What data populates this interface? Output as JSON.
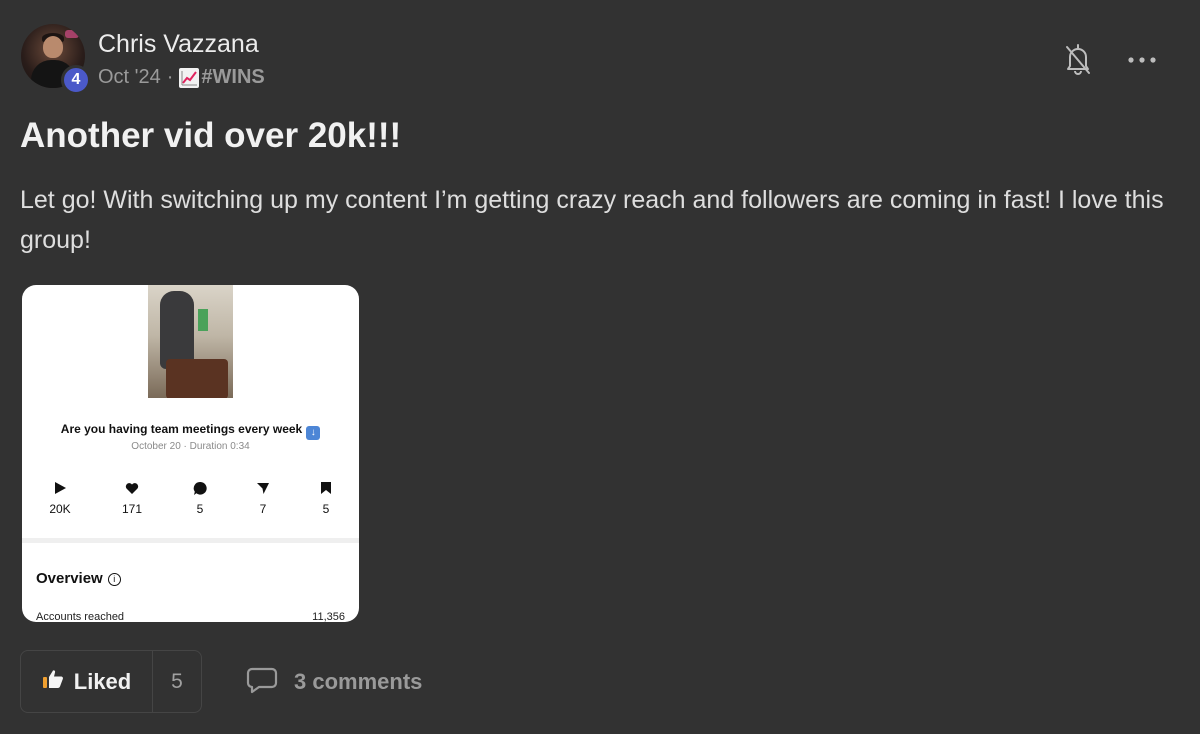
{
  "post": {
    "author": "Chris Vazzana",
    "level": "4",
    "date": "Oct '24",
    "separator": "·",
    "category": "#WINS",
    "category_icon": "chart-increasing-icon",
    "title": "Another vid over 20k!!!",
    "body": "Let go! With switching up my content I’m getting crazy reach and followers are coming in fast! I love this group!"
  },
  "attachment": {
    "caption": "Are you having team meetings every week",
    "subcaption": "October 20 · Duration 0:34",
    "stats": [
      {
        "icon": "play-icon",
        "value": "20K"
      },
      {
        "icon": "heart-icon",
        "value": "171"
      },
      {
        "icon": "comment-icon",
        "value": "5"
      },
      {
        "icon": "share-icon",
        "value": "7"
      },
      {
        "icon": "bookmark-icon",
        "value": "5"
      }
    ],
    "overview_label": "Overview",
    "accounts_reached_label": "Accounts reached",
    "accounts_reached_value": "11,356"
  },
  "actions": {
    "like_label": "Liked",
    "like_count": "5",
    "comments_label": "3 comments"
  },
  "colors": {
    "background": "#323232",
    "badge": "#4b59c9",
    "muted_text": "#9a9a9a"
  }
}
